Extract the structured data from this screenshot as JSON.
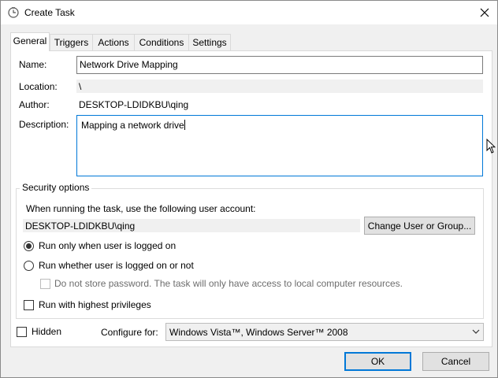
{
  "window": {
    "title": "Create Task",
    "title_icon": "clock-icon",
    "close_icon": "close-icon"
  },
  "tabs": [
    {
      "label": "General",
      "active": true
    },
    {
      "label": "Triggers",
      "active": false
    },
    {
      "label": "Actions",
      "active": false
    },
    {
      "label": "Conditions",
      "active": false
    },
    {
      "label": "Settings",
      "active": false
    }
  ],
  "general": {
    "name_label": "Name:",
    "name_value": "Network Drive Mapping",
    "location_label": "Location:",
    "location_value": "\\",
    "author_label": "Author:",
    "author_value": "DESKTOP-LDIDKBU\\qing",
    "description_label": "Description:",
    "description_value": "Mapping a network drive"
  },
  "security": {
    "title": "Security options",
    "account_prompt": "When running the task, use the following user account:",
    "account_value": "DESKTOP-LDIDKBU\\qing",
    "change_button": "Change User or Group...",
    "radio_logged_on": "Run only when user is logged on",
    "radio_logged_on_checked": true,
    "radio_whether": "Run whether user is logged on or not",
    "radio_whether_checked": false,
    "no_store_password": "Do not store password.  The task will only have access to local computer resources.",
    "highest_privileges": "Run with highest privileges"
  },
  "footer": {
    "hidden_label": "Hidden",
    "configure_label": "Configure for:",
    "configure_value": "Windows Vista™, Windows Server™ 2008",
    "ok_button": "OK",
    "cancel_button": "Cancel"
  },
  "colors": {
    "focus": "#0078d7",
    "dialog_bg": "#f0f0f0",
    "panel_bg": "#ffffff"
  }
}
